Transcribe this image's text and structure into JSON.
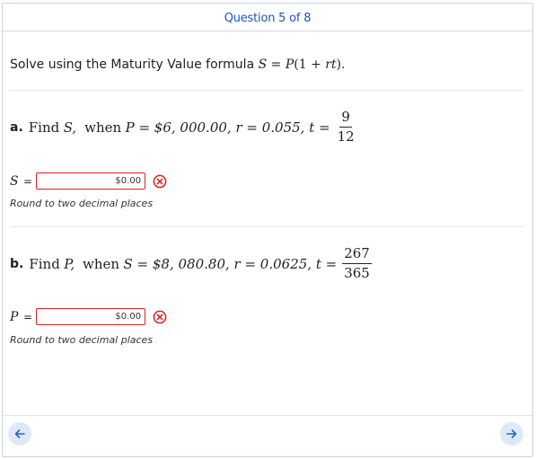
{
  "header": {
    "title": "Question 5 of 8"
  },
  "instruction": {
    "prefix": "Solve using the Maturity Value formula"
  },
  "part_a": {
    "letter": "a.",
    "text": "Find",
    "find_var": "S,",
    "when": "when",
    "cond": "P = $6, 000.00, r = 0.055, t =",
    "t_num": "9",
    "t_den": "12",
    "answer_var": "S",
    "answer_value": "$0.00",
    "hint": "Round to two decimal places"
  },
  "part_b": {
    "letter": "b.",
    "text": "Find",
    "find_var": "P,",
    "when": "when",
    "cond": "S = $8, 080.80, r = 0.0625, t =",
    "t_num": "267",
    "t_den": "365",
    "answer_var": "P",
    "answer_value": "$0.00",
    "hint": "Round to two decimal places"
  },
  "colors": {
    "accent": "#1a56c4",
    "error": "#dd2222",
    "nav_bg": "#dde9f8"
  },
  "icons": {
    "wrong": "x-circle-icon",
    "prev": "arrow-left-icon",
    "next": "arrow-right-icon"
  }
}
